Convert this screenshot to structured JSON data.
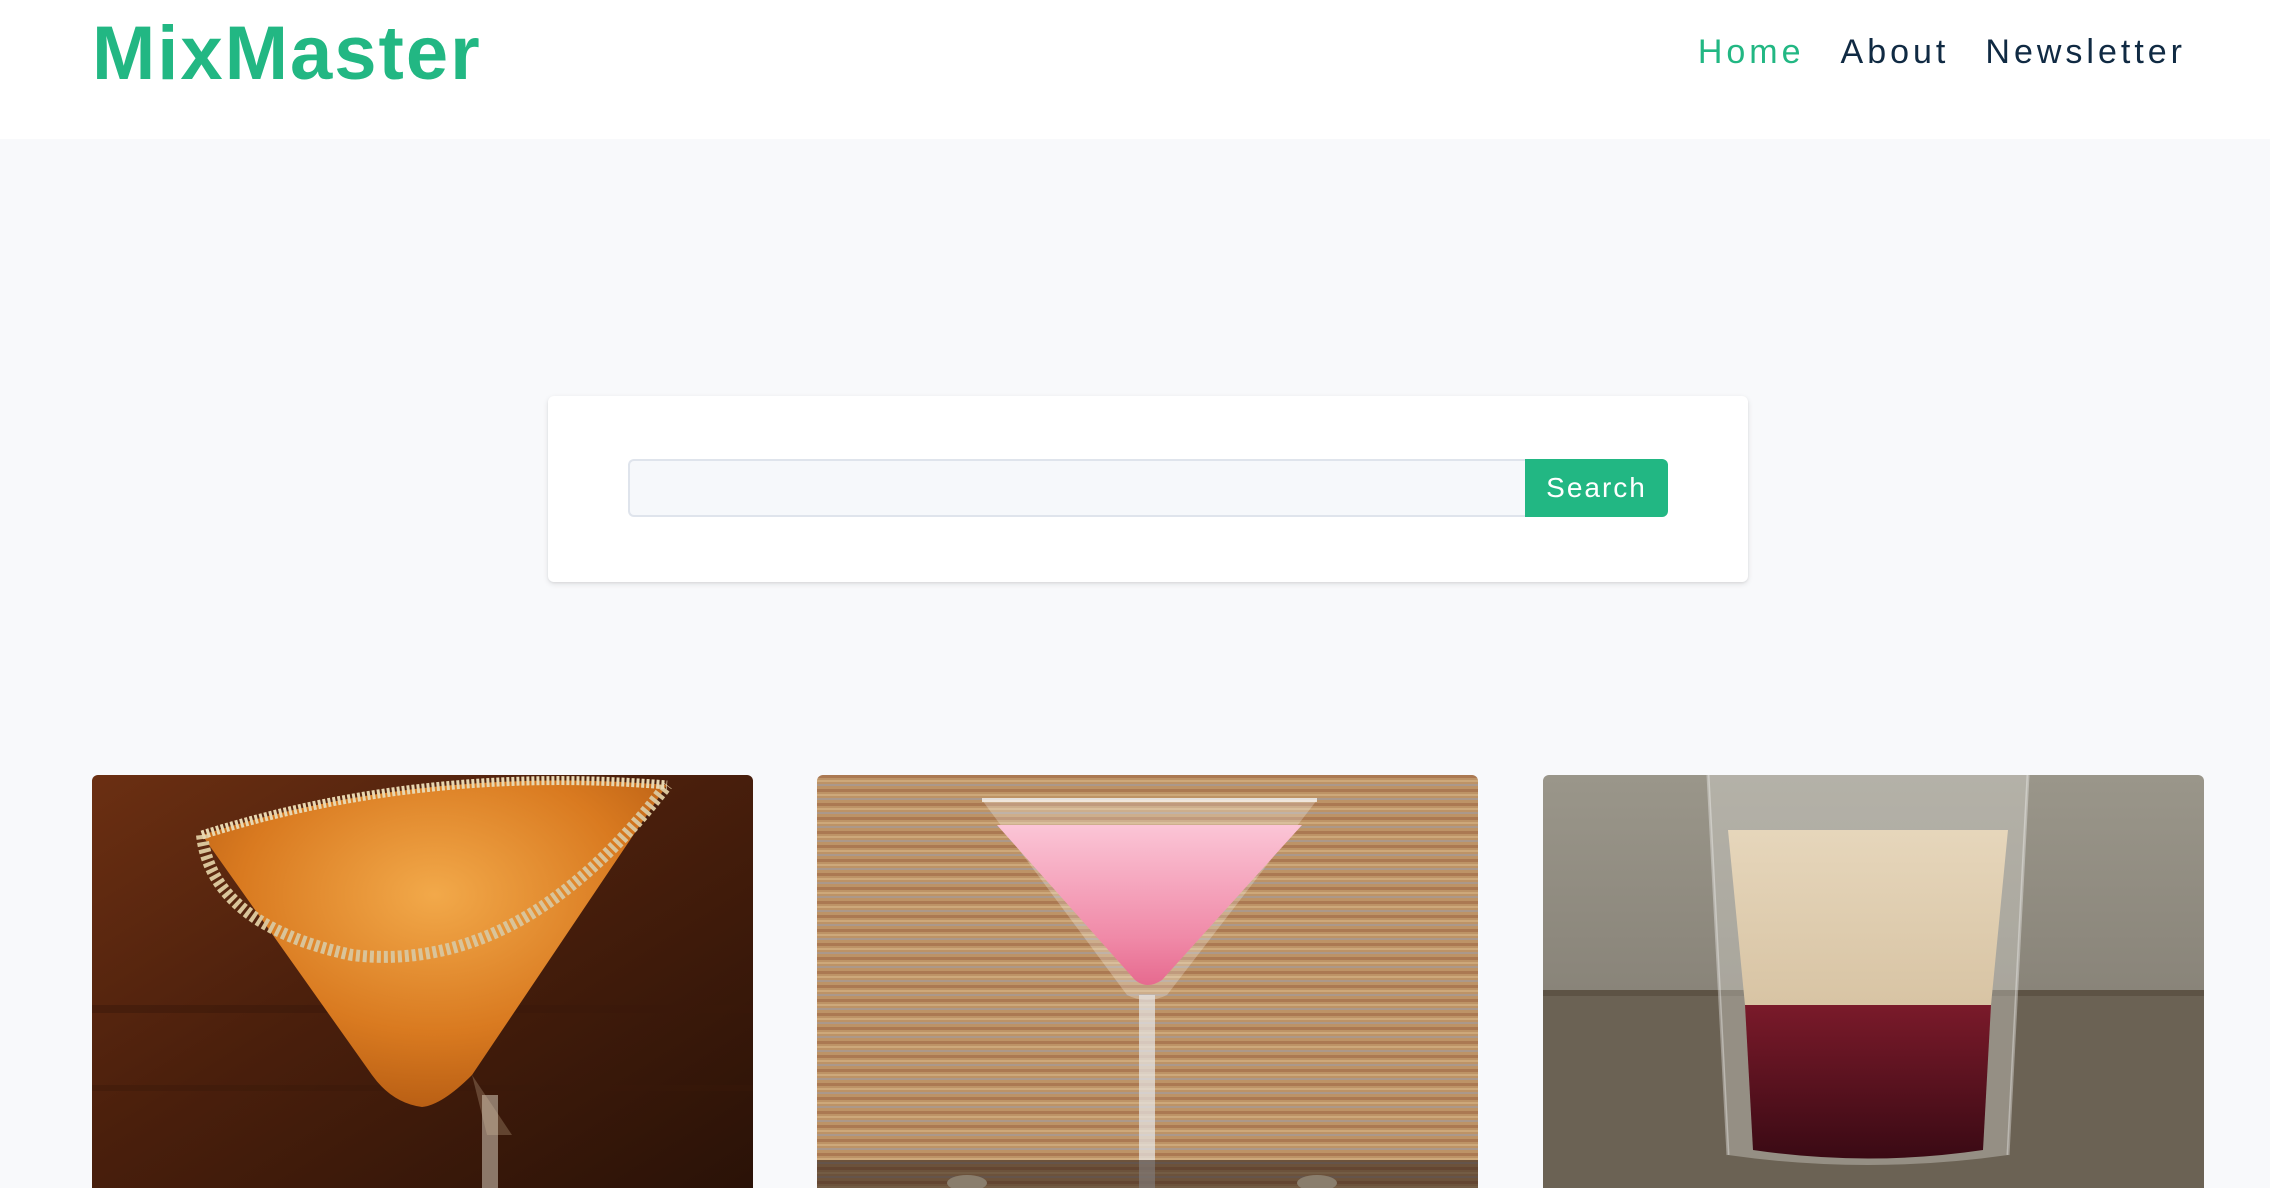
{
  "brand": {
    "name": "MixMaster",
    "color": "#22b783"
  },
  "nav": {
    "items": [
      {
        "label": "Home",
        "active": true
      },
      {
        "label": "About",
        "active": false
      },
      {
        "label": "Newsletter",
        "active": false
      }
    ]
  },
  "search": {
    "value": "",
    "placeholder": "",
    "button_label": "Search"
  },
  "cocktails": [
    {
      "image": "orange-martini-with-sugared-rim"
    },
    {
      "image": "pink-martini"
    },
    {
      "image": "layered-shot-cream-over-red"
    }
  ],
  "colors": {
    "accent": "#22b783",
    "nav_text": "#102a43",
    "page_bg": "#f8f9fb"
  }
}
